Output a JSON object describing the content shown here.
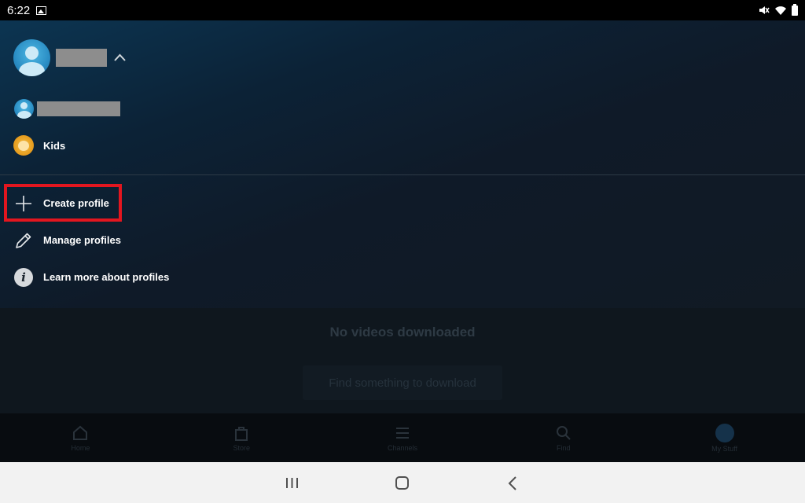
{
  "status_bar": {
    "time": "6:22",
    "icons": [
      "image-icon",
      "mute-icon",
      "wifi-icon",
      "battery-icon"
    ]
  },
  "profile_panel": {
    "current_profile": {
      "name": "",
      "name_redacted": true
    },
    "profiles": [
      {
        "name": "",
        "name_redacted": true,
        "avatar": "user-avatar"
      },
      {
        "name": "Kids",
        "avatar": "kids-avatar"
      }
    ],
    "actions": [
      {
        "label": "Create profile",
        "icon": "plus-icon",
        "highlighted": true
      },
      {
        "label": "Manage profiles",
        "icon": "pencil-icon"
      },
      {
        "label": "Learn more about profiles",
        "icon": "info-icon"
      }
    ],
    "highlight_color": "#e3161f"
  },
  "background": {
    "empty_title": "No videos downloaded",
    "find_button": "Find something to download",
    "nav_items": [
      {
        "label": "Home",
        "icon": "home-icon"
      },
      {
        "label": "Store",
        "icon": "store-bag-icon"
      },
      {
        "label": "Channels",
        "icon": "channels-icon"
      },
      {
        "label": "Find",
        "icon": "search-icon"
      },
      {
        "label": "My Stuff",
        "icon": "profile-avatar-icon",
        "active": true
      }
    ]
  },
  "android_nav": {
    "buttons": [
      "recent-apps-button",
      "home-button",
      "back-button"
    ]
  }
}
